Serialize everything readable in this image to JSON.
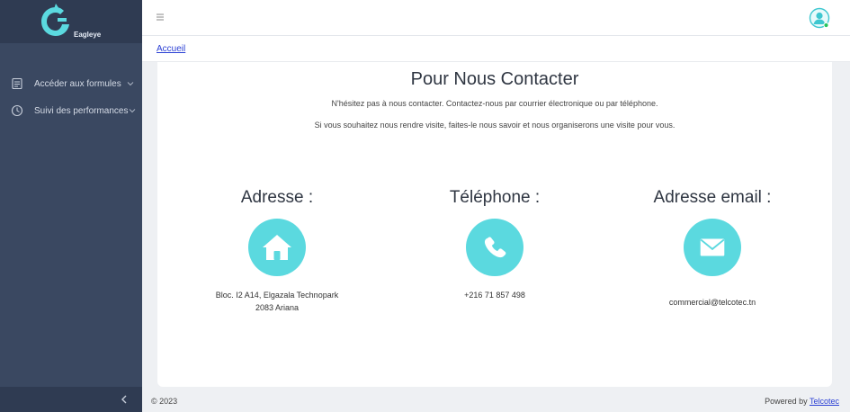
{
  "app": {
    "brand_name": "Eagleye"
  },
  "sidebar": {
    "items": [
      {
        "label": "Accéder aux formules",
        "icon": "document-icon"
      },
      {
        "label": "Suivi des performances",
        "icon": "clock-icon"
      }
    ]
  },
  "breadcrumb": {
    "home": "Accueil"
  },
  "contact": {
    "title": "Pour Nous Contacter",
    "intro1": "N'hésitez pas à nous contacter. Contactez-nous par courrier électronique ou par téléphone.",
    "intro2": "Si vous souhaitez nous rendre visite, faites-le nous savoir et nous organiserons une visite pour vous.",
    "address": {
      "title": "Adresse :",
      "line1": "Bloc. I2 A14, Elgazala Technopark",
      "line2": "2083 Ariana",
      "icon": "home-icon"
    },
    "phone": {
      "title": "Téléphone :",
      "value": "+216 71 857 498",
      "icon": "phone-icon"
    },
    "email": {
      "title": "Adresse email :",
      "value": "commercial@telcotec.tn",
      "icon": "envelope-icon"
    }
  },
  "footer": {
    "copyright": "© 2023",
    "powered_prefix": "Powered by",
    "powered_link": "Telcotec"
  },
  "colors": {
    "sidebar": "#3a4861",
    "sidebar_dark": "#2f3b52",
    "accent": "#5bd9df",
    "link": "#2a3fd4"
  }
}
